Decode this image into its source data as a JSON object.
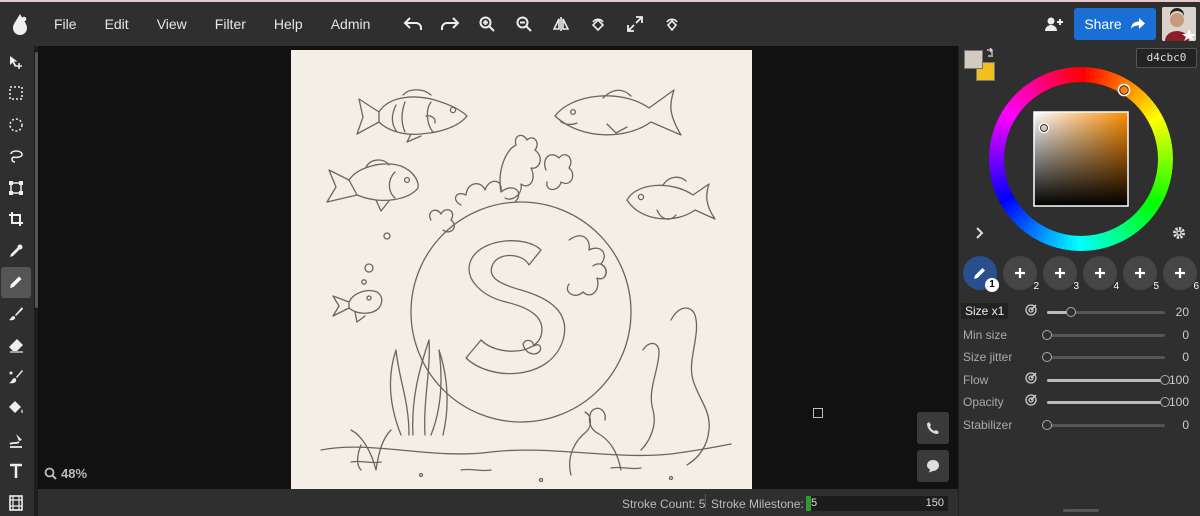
{
  "menu": [
    "File",
    "Edit",
    "View",
    "Filter",
    "Help",
    "Admin"
  ],
  "toolbar": {
    "icons": [
      "undo-icon",
      "redo-icon",
      "zoom-in-icon",
      "zoom-out-icon",
      "flip-icon",
      "rotate-icon",
      "fullscreen-icon",
      "hand-icon"
    ]
  },
  "share": {
    "label": "Share"
  },
  "left_tools": [
    "move-icon",
    "rect-select-icon",
    "ellipse-select-icon",
    "lasso-icon",
    "transform-icon",
    "crop-icon",
    "eyedropper-icon",
    "pen-icon",
    "brush-icon",
    "eraser-icon",
    "blend-icon",
    "fill-icon",
    "shape-icon",
    "text-icon",
    "filmstrip-icon"
  ],
  "active_tool": "pen-icon",
  "canvas": {
    "zoom": "48%"
  },
  "status": {
    "stroke_count": "Stroke Count: 5",
    "milestone_label": "Stroke Milestone:",
    "milestone_value": "5",
    "milestone_max": "150",
    "milestone_fraction": 0.033
  },
  "color": {
    "hex": "d4cbc0",
    "primary": "#d4cbc0",
    "secondary": "#f0c020",
    "picker_hue": "#ff8c00"
  },
  "brush_slots": [
    "1",
    "2",
    "3",
    "4",
    "5",
    "6"
  ],
  "brush_props": [
    {
      "label": "Size x1",
      "value": "20",
      "level": 0.2,
      "icon": true,
      "selected": true
    },
    {
      "label": "Min size",
      "value": "0",
      "level": 0.0,
      "icon": false,
      "selected": false
    },
    {
      "label": "Size jitter",
      "value": "0",
      "level": 0.0,
      "icon": false,
      "selected": false
    },
    {
      "label": "Flow",
      "value": "100",
      "level": 1.0,
      "icon": true,
      "selected": false
    },
    {
      "label": "Opacity",
      "value": "100",
      "level": 1.0,
      "icon": true,
      "selected": false
    },
    {
      "label": "Stabilizer",
      "value": "0",
      "level": 0.0,
      "icon": false,
      "selected": false
    }
  ]
}
